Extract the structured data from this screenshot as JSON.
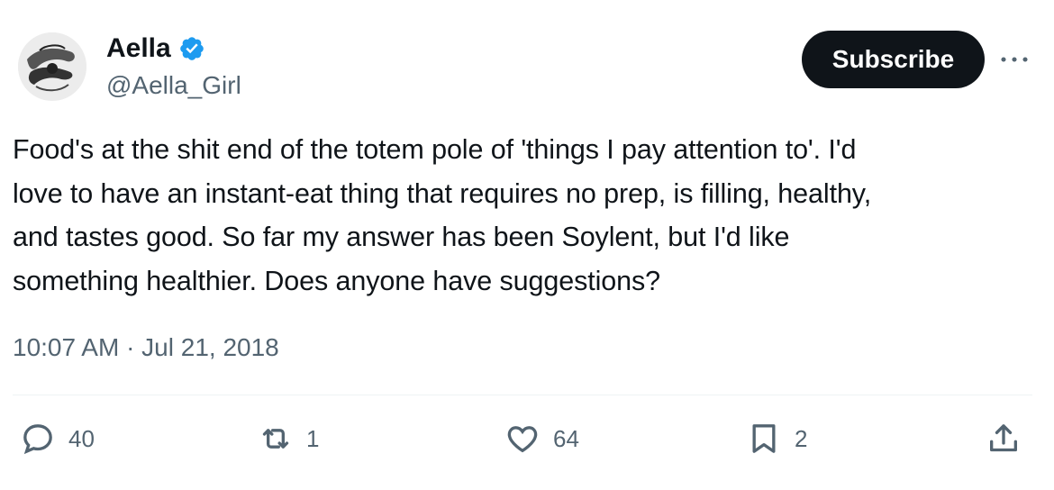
{
  "author": {
    "name": "Aella",
    "handle": "@Aella_Girl",
    "verified_icon": "verified-badge-icon",
    "verified_color": "#1d9bf0"
  },
  "subscribe_label": "Subscribe",
  "tweet": {
    "lines": [
      "Food's at the shit end of the totem pole of 'things I pay attention to'. I'd",
      "love to have an instant-eat thing that requires no prep, is filling, healthy,",
      "and tastes good. So far my answer has been Soylent, but I'd like",
      "something healthier. Does anyone have suggestions?"
    ],
    "timestamp": "10:07 AM · Jul 21, 2018"
  },
  "actions": {
    "replies": "40",
    "retweets": "1",
    "likes": "64",
    "bookmarks": "2"
  },
  "colors": {
    "text": "#0f1419",
    "muted": "#536471",
    "button_bg": "#0f1419"
  }
}
